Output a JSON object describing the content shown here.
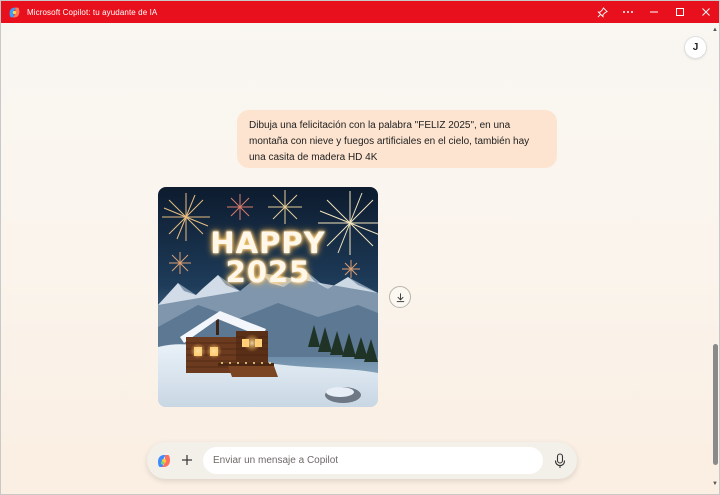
{
  "window": {
    "title": "Microsoft Copilot: tu ayudante de IA",
    "accent_color": "#e8101c",
    "controls": [
      "pin-icon",
      "more-icon",
      "minimize-icon",
      "maximize-icon",
      "close-icon"
    ]
  },
  "user": {
    "avatar_initial": "J"
  },
  "conversation": {
    "user_message": "Dibuja una felicitación con la palabra \"FELIZ 2025\", en una montaña con nieve y fuegos artificiales en el cielo, también hay una casita de madera HD 4K",
    "generated_image": {
      "text_line1": "HAPPY",
      "text_line2": "2025"
    },
    "download_icon": "download-icon"
  },
  "composer": {
    "placeholder": "Enviar un mensaje a Copilot",
    "value": "",
    "icons": [
      "copilot-logo-icon",
      "plus-icon",
      "microphone-icon"
    ]
  }
}
